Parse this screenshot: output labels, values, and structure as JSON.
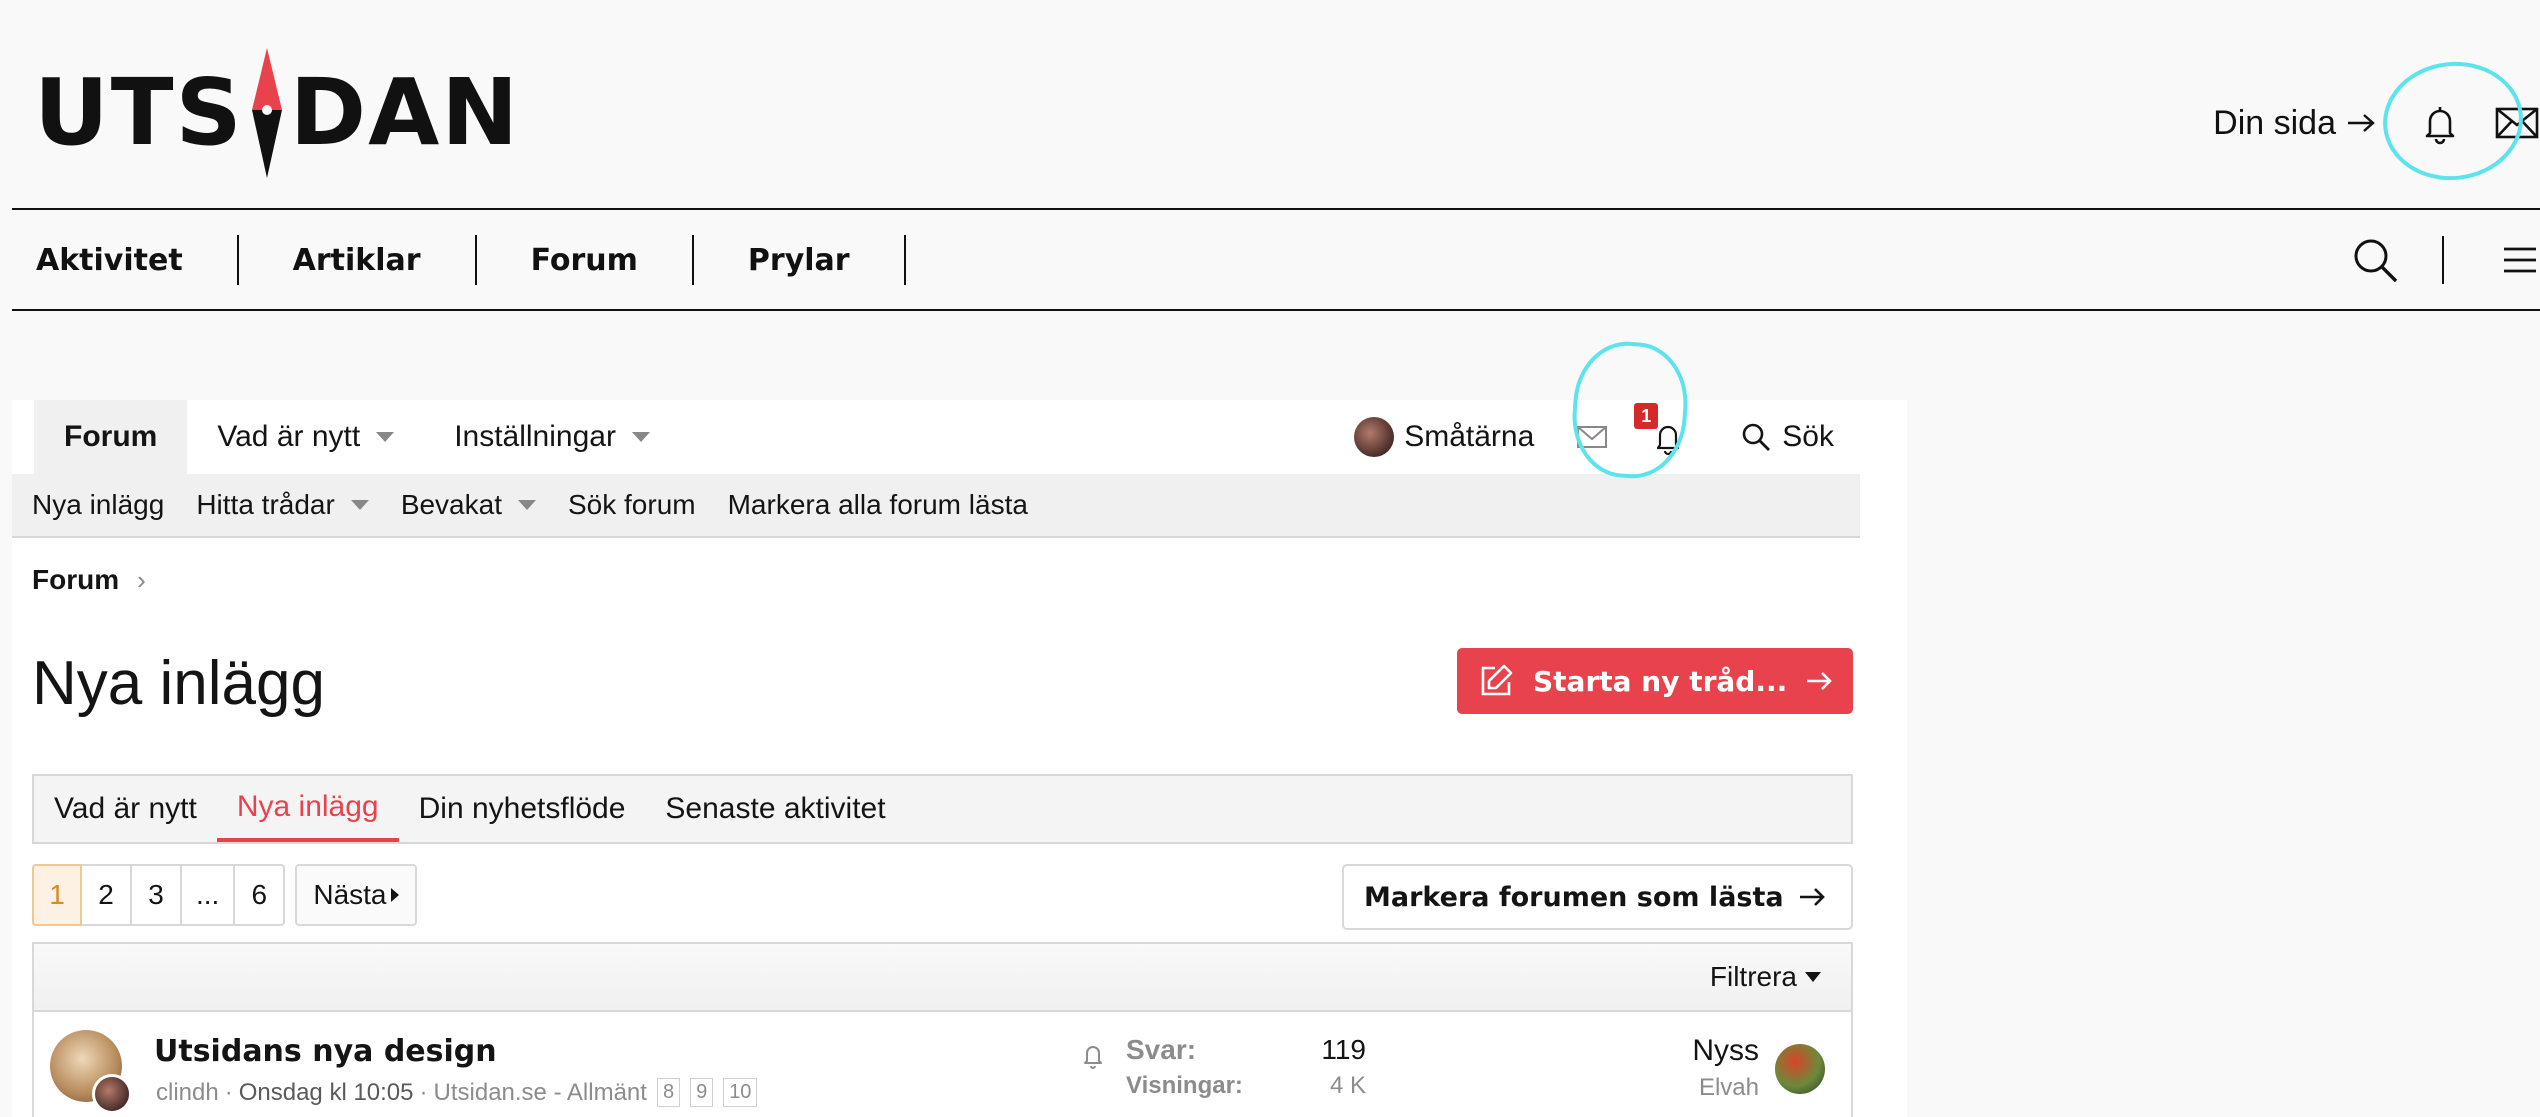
{
  "site": {
    "logo_left": "UTS",
    "logo_right": "DAN",
    "din_sida": "Din sida",
    "nav": [
      "Aktivitet",
      "Artiklar",
      "Forum",
      "Prylar"
    ],
    "icons": {
      "bell": "bell-icon",
      "mail": "mail-icon",
      "search": "search-icon",
      "menu": "hamburger-menu-icon"
    }
  },
  "forum_tabs": {
    "items": [
      "Forum",
      "Vad är nytt",
      "Inställningar"
    ],
    "user_name": "Småtärna",
    "notification_count": "1",
    "search_label": "Sök"
  },
  "subnav": [
    "Nya inlägg",
    "Hitta trådar",
    "Bevakat",
    "Sök forum",
    "Markera alla forum lästa"
  ],
  "breadcrumb": "Forum",
  "page": {
    "title": "Nya inlägg",
    "new_thread_button": "Starta ny tråd...",
    "tabs": [
      "Vad är nytt",
      "Nya inlägg",
      "Din nyhetsflöde",
      "Senaste aktivitet"
    ],
    "active_tab": "Nya inlägg"
  },
  "pagination": {
    "pages": [
      "1",
      "2",
      "3",
      "...",
      "6"
    ],
    "current": "1",
    "next": "Nästa"
  },
  "mark_forums_read": "Markera forumen som lästa",
  "filter_label": "Filtrera",
  "threads": [
    {
      "title": "Utsidans nya design",
      "author": "clindh",
      "date": "Onsdag kl 10:05",
      "forum": "Utsidan.se - Allmänt",
      "mini_pages": [
        "8",
        "9",
        "10"
      ],
      "replies_label": "Svar:",
      "replies": "119",
      "views_label": "Visningar:",
      "views": "4 K",
      "last_time": "Nyss",
      "last_user": "Elvah"
    }
  ],
  "colors": {
    "accent": "#e8424d",
    "annotation": "#5ce3ee",
    "badge": "#d52a2a"
  }
}
